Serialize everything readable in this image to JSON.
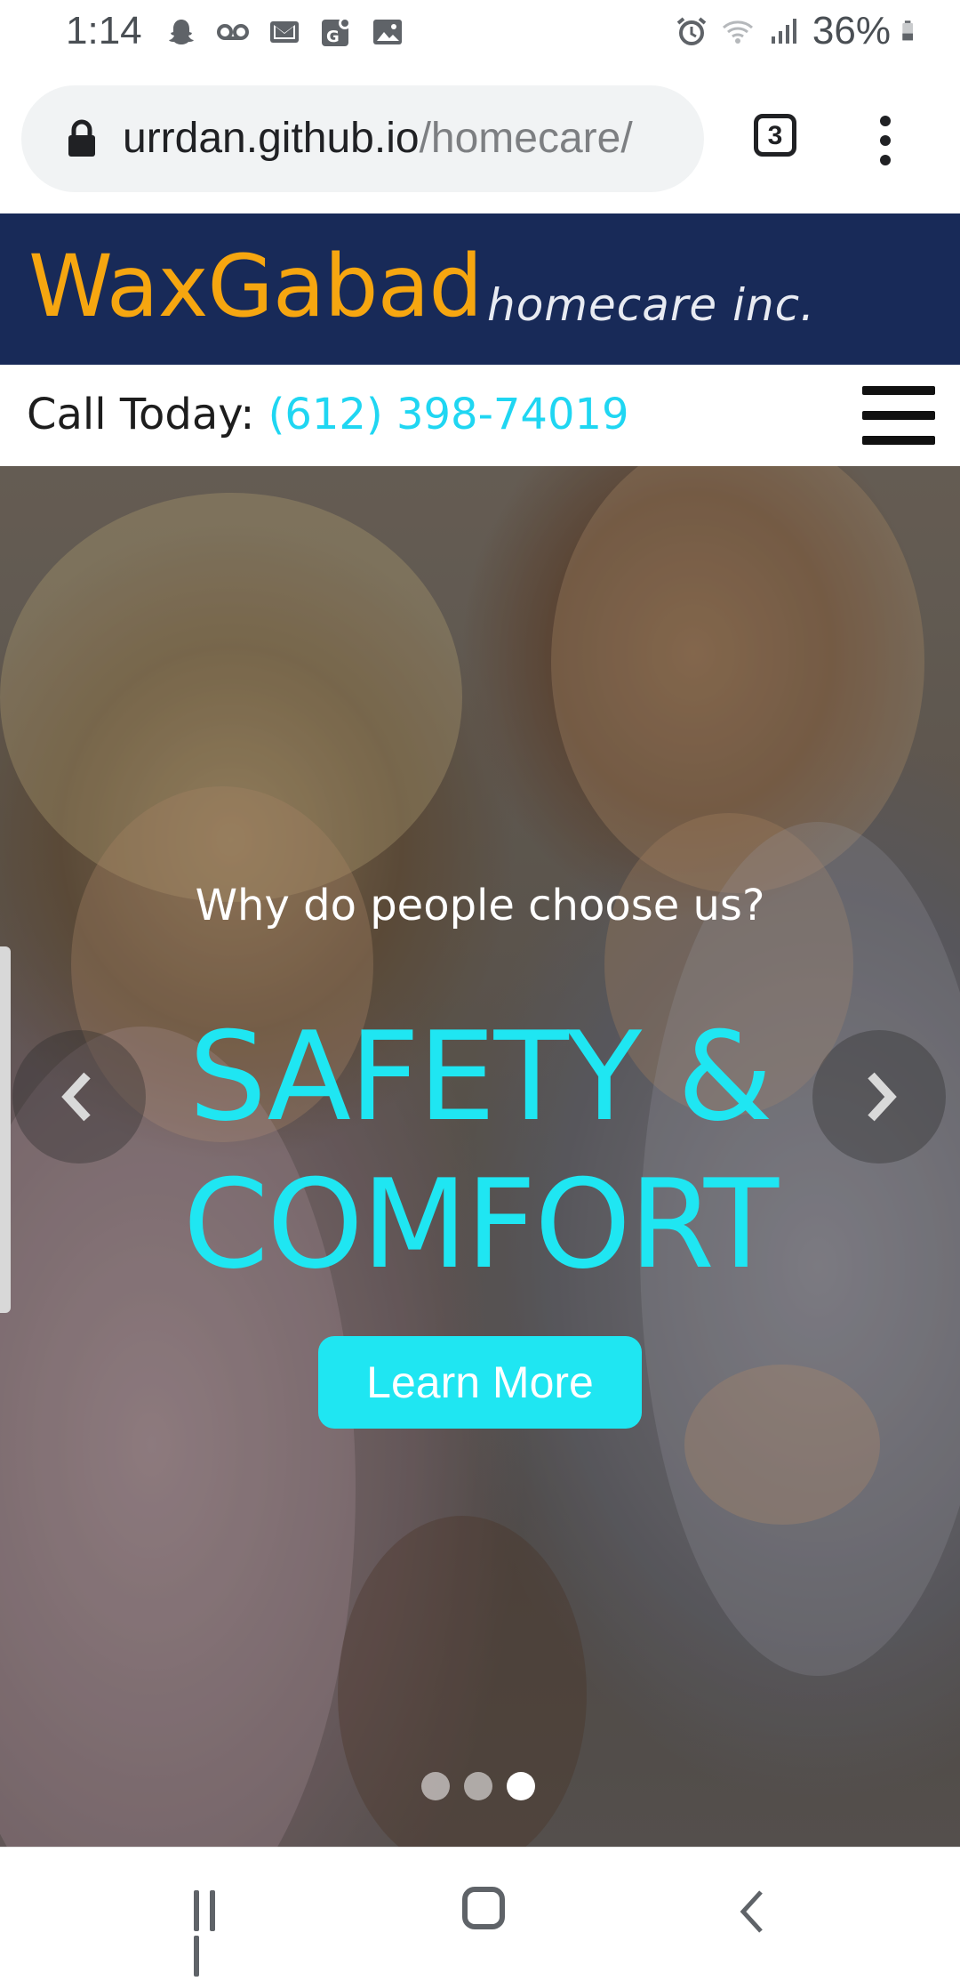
{
  "status_bar": {
    "time": "1:14",
    "battery": "36%",
    "icons_left": [
      "snapchat-icon",
      "voicemail-icon",
      "gmail-icon",
      "maps-icon",
      "gallery-icon"
    ],
    "icons_right": [
      "alarm-icon",
      "wifi-icon",
      "signal-icon",
      "battery-icon"
    ]
  },
  "browser": {
    "url_domain": "urrdan.github.io",
    "url_path": "/homecare/",
    "tab_count": "3"
  },
  "site": {
    "logo_name": "WaxGabad",
    "logo_tagline": "homecare inc.",
    "call_label": "Call Today: ",
    "phone": "(612) 398-74019"
  },
  "hero": {
    "question": "Why do people choose us?",
    "headline_line1": "SAFETY &",
    "headline_line2": "COMFORT",
    "cta_label": "Learn More",
    "slide_count": 3,
    "active_slide": 3
  },
  "colors": {
    "header_bg": "#182a58",
    "logo": "#f6a610",
    "accent_cyan": "#1fe6f2",
    "phone": "#1fd6f2"
  }
}
